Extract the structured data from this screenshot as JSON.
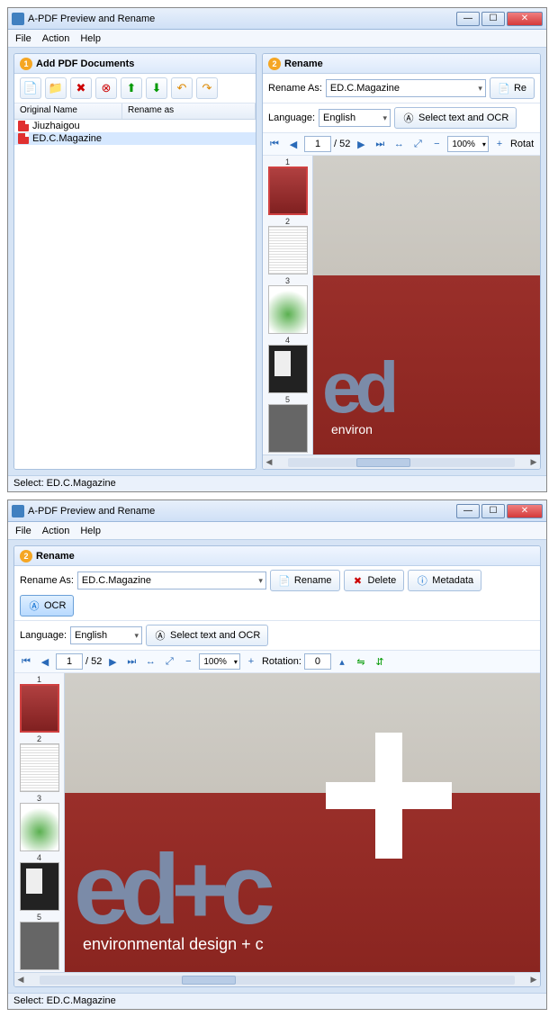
{
  "app": {
    "title": "A-PDF Preview and Rename"
  },
  "menu": {
    "file": "File",
    "action": "Action",
    "help": "Help"
  },
  "win": {
    "min": "—",
    "max": "☐",
    "close": "✕"
  },
  "panel1": {
    "title": "Add PDF Documents",
    "col_original": "Original Name",
    "col_rename": "Rename as",
    "files": {
      "f1": "Jiuzhaigou",
      "f2": "ED.C.Magazine"
    }
  },
  "panel2": {
    "title": "Rename",
    "rename_as_label": "Rename As:",
    "rename_value": "ED.C.Magazine",
    "language_label": "Language:",
    "language_value": "English",
    "select_ocr": "Select text and OCR",
    "rename_btn": "Rename",
    "delete_btn": "Delete",
    "metadata_btn": "Metadata",
    "ocr_btn": "OCR",
    "re_short": "Re"
  },
  "nav": {
    "page": "1",
    "total": "/ 52",
    "zoom": "100%",
    "rotation_label": "Rotation:",
    "rotation_val": "0",
    "rotat_short": "Rotat"
  },
  "thumbs": {
    "n1": "1",
    "n2": "2",
    "n3": "3",
    "n4": "4",
    "n5": "5"
  },
  "cover": {
    "logo_short": "ed",
    "sub_short": "environ",
    "logo_full": "ed+c",
    "sub_full": "environmental design + c"
  },
  "status": {
    "text": "Select: ED.C.Magazine"
  }
}
